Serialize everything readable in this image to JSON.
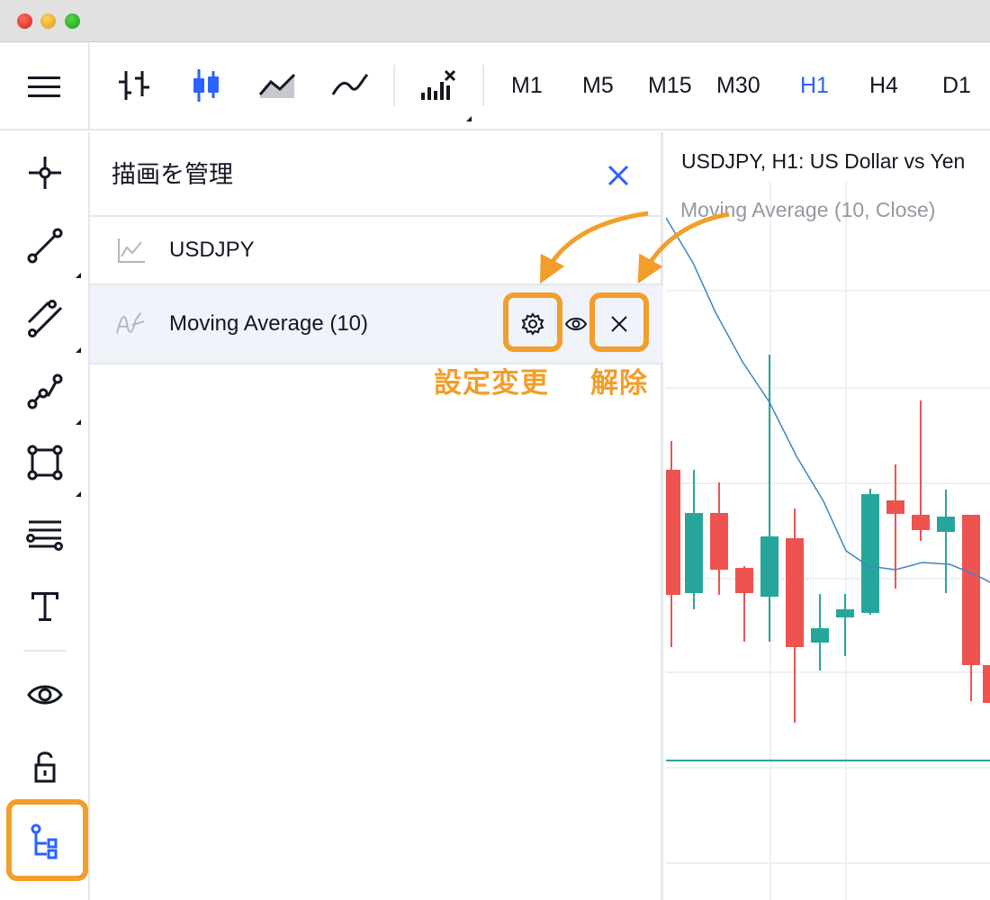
{
  "toolbar": {
    "chart_types": [
      {
        "name": "bars-icon",
        "active": false
      },
      {
        "name": "candles-icon",
        "active": true
      },
      {
        "name": "area-icon",
        "active": false
      },
      {
        "name": "line-icon",
        "active": false
      }
    ],
    "timeframes": [
      {
        "label": "M1",
        "active": false
      },
      {
        "label": "M5",
        "active": false
      },
      {
        "label": "M15",
        "active": false
      },
      {
        "label": "M30",
        "active": false
      },
      {
        "label": "H1",
        "active": true
      },
      {
        "label": "H4",
        "active": false
      },
      {
        "label": "D1",
        "active": false
      }
    ]
  },
  "sidebar": {
    "tools": [
      "crosshair-icon",
      "trend-line-icon",
      "parallel-channel-icon",
      "polyline-icon",
      "rectangle-icon",
      "fib-retracement-icon",
      "text-icon",
      "eye-icon",
      "unlock-icon",
      "object-tree-icon"
    ],
    "highlighted": "object-tree-icon"
  },
  "panel": {
    "title": "描画を管理",
    "items": [
      {
        "label": "USDJPY",
        "icon": "chart-line-icon",
        "selected": false
      },
      {
        "label": "Moving Average (10)",
        "icon": "indicator-icon",
        "selected": true
      }
    ],
    "callouts": {
      "settings": "設定変更",
      "remove": "解除"
    }
  },
  "chart": {
    "title": "USDJPY, H1: US Dollar vs Yen",
    "indicator": "Moving Average (10, Close)"
  },
  "colors": {
    "accent": "#2962ff",
    "highlight": "#f19e2a",
    "up": "#26a69a",
    "down": "#ef5350",
    "ma_line": "#3a86c8"
  }
}
